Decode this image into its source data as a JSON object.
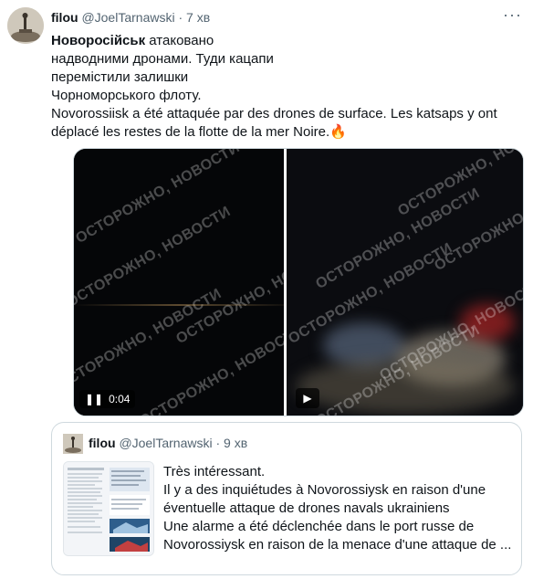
{
  "tweet": {
    "display_name": "filou",
    "handle": "@JoelTarnawski",
    "separator": "·",
    "time": "7 хв",
    "more_label": "···",
    "text_line1_bold": "Новоросійськ",
    "text_line1_rest": " атаковано",
    "text_line2": "надводними дронами. Туди кацапи",
    "text_line3": "перемістили залишки",
    "text_line4": "Чорноморського флоту.",
    "text_line5": "Novorossiisk a été attaquée par des drones de surface. Les katsaps y ont",
    "text_line6": "déplacé les restes de la flotte de la mer Noire.",
    "emoji": "🔥"
  },
  "media": {
    "watermark": "ОСТОРОЖНО, НОВОСТИ",
    "video1_time": "0:04",
    "pause_icon": "❚❚",
    "play_icon": "▶"
  },
  "quote": {
    "display_name": "filou",
    "handle": "@JoelTarnawski",
    "separator": "·",
    "time": "9 хв",
    "line1": "Très intéressant.",
    "line2": "Il y a des inquiétudes à Novorossiysk en raison d'une",
    "line3": "éventuelle attaque de drones navals ukrainiens",
    "line4": "Une alarme a été déclenchée dans le port russe de",
    "line5": "Novorossiysk en raison de la menace d'une attaque de ..."
  }
}
